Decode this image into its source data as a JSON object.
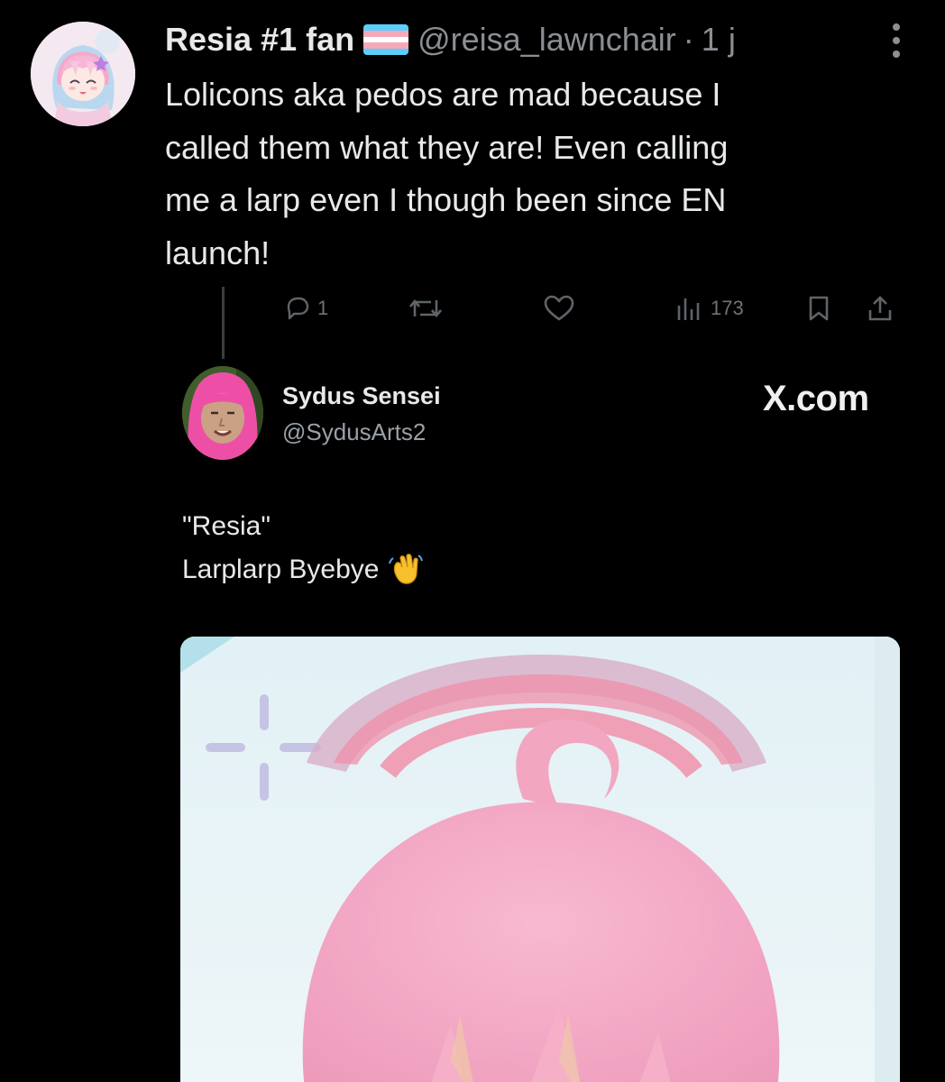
{
  "tweet": {
    "display_name": "Resia #1 fan",
    "flag_icon": "transgender-flag-icon",
    "flag_colors": [
      "#5bcefa",
      "#f5a9b8",
      "#ffffff",
      "#f5a9b8",
      "#5bcefa"
    ],
    "handle": "@reisa_lawnchair",
    "separator": "·",
    "time": "1 j",
    "text": "Lolicons aka pedos are mad because I\ncalled them what they are! Even calling\nme a larp even I though been since EN\nlaunch!",
    "actions": {
      "reply_count": "1",
      "views_count": "173"
    }
  },
  "quoted": {
    "display_name": "Sydus Sensei",
    "handle": "@SydusArts2",
    "brand": "X.com",
    "text_line1": "\"Resia\"",
    "text_line2": "Larplarp Byebye",
    "emoji": "waving-hand-emoji"
  },
  "colors": {
    "background": "#000000",
    "text": "#e7e9ea",
    "muted": "#8b8f94",
    "action": "#6e7378"
  }
}
